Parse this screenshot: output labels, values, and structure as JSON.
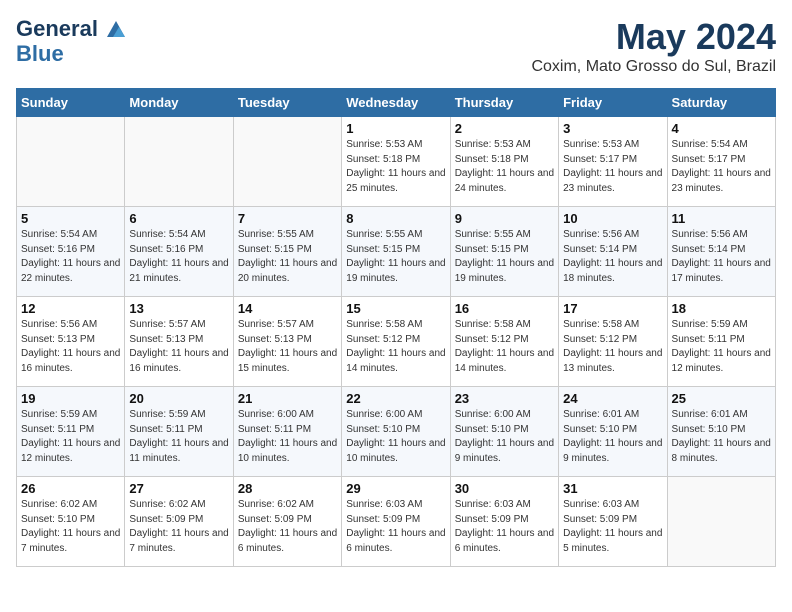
{
  "header": {
    "logo_line1": "General",
    "logo_line2": "Blue",
    "month": "May 2024",
    "location": "Coxim, Mato Grosso do Sul, Brazil"
  },
  "days_of_week": [
    "Sunday",
    "Monday",
    "Tuesday",
    "Wednesday",
    "Thursday",
    "Friday",
    "Saturday"
  ],
  "weeks": [
    [
      {
        "day": null
      },
      {
        "day": null
      },
      {
        "day": null
      },
      {
        "day": "1",
        "sunrise": "5:53 AM",
        "sunset": "5:18 PM",
        "daylight": "11 hours and 25 minutes."
      },
      {
        "day": "2",
        "sunrise": "5:53 AM",
        "sunset": "5:18 PM",
        "daylight": "11 hours and 24 minutes."
      },
      {
        "day": "3",
        "sunrise": "5:53 AM",
        "sunset": "5:17 PM",
        "daylight": "11 hours and 23 minutes."
      },
      {
        "day": "4",
        "sunrise": "5:54 AM",
        "sunset": "5:17 PM",
        "daylight": "11 hours and 23 minutes."
      }
    ],
    [
      {
        "day": "5",
        "sunrise": "5:54 AM",
        "sunset": "5:16 PM",
        "daylight": "11 hours and 22 minutes."
      },
      {
        "day": "6",
        "sunrise": "5:54 AM",
        "sunset": "5:16 PM",
        "daylight": "11 hours and 21 minutes."
      },
      {
        "day": "7",
        "sunrise": "5:55 AM",
        "sunset": "5:15 PM",
        "daylight": "11 hours and 20 minutes."
      },
      {
        "day": "8",
        "sunrise": "5:55 AM",
        "sunset": "5:15 PM",
        "daylight": "11 hours and 19 minutes."
      },
      {
        "day": "9",
        "sunrise": "5:55 AM",
        "sunset": "5:15 PM",
        "daylight": "11 hours and 19 minutes."
      },
      {
        "day": "10",
        "sunrise": "5:56 AM",
        "sunset": "5:14 PM",
        "daylight": "11 hours and 18 minutes."
      },
      {
        "day": "11",
        "sunrise": "5:56 AM",
        "sunset": "5:14 PM",
        "daylight": "11 hours and 17 minutes."
      }
    ],
    [
      {
        "day": "12",
        "sunrise": "5:56 AM",
        "sunset": "5:13 PM",
        "daylight": "11 hours and 16 minutes."
      },
      {
        "day": "13",
        "sunrise": "5:57 AM",
        "sunset": "5:13 PM",
        "daylight": "11 hours and 16 minutes."
      },
      {
        "day": "14",
        "sunrise": "5:57 AM",
        "sunset": "5:13 PM",
        "daylight": "11 hours and 15 minutes."
      },
      {
        "day": "15",
        "sunrise": "5:58 AM",
        "sunset": "5:12 PM",
        "daylight": "11 hours and 14 minutes."
      },
      {
        "day": "16",
        "sunrise": "5:58 AM",
        "sunset": "5:12 PM",
        "daylight": "11 hours and 14 minutes."
      },
      {
        "day": "17",
        "sunrise": "5:58 AM",
        "sunset": "5:12 PM",
        "daylight": "11 hours and 13 minutes."
      },
      {
        "day": "18",
        "sunrise": "5:59 AM",
        "sunset": "5:11 PM",
        "daylight": "11 hours and 12 minutes."
      }
    ],
    [
      {
        "day": "19",
        "sunrise": "5:59 AM",
        "sunset": "5:11 PM",
        "daylight": "11 hours and 12 minutes."
      },
      {
        "day": "20",
        "sunrise": "5:59 AM",
        "sunset": "5:11 PM",
        "daylight": "11 hours and 11 minutes."
      },
      {
        "day": "21",
        "sunrise": "6:00 AM",
        "sunset": "5:11 PM",
        "daylight": "11 hours and 10 minutes."
      },
      {
        "day": "22",
        "sunrise": "6:00 AM",
        "sunset": "5:10 PM",
        "daylight": "11 hours and 10 minutes."
      },
      {
        "day": "23",
        "sunrise": "6:00 AM",
        "sunset": "5:10 PM",
        "daylight": "11 hours and 9 minutes."
      },
      {
        "day": "24",
        "sunrise": "6:01 AM",
        "sunset": "5:10 PM",
        "daylight": "11 hours and 9 minutes."
      },
      {
        "day": "25",
        "sunrise": "6:01 AM",
        "sunset": "5:10 PM",
        "daylight": "11 hours and 8 minutes."
      }
    ],
    [
      {
        "day": "26",
        "sunrise": "6:02 AM",
        "sunset": "5:10 PM",
        "daylight": "11 hours and 7 minutes."
      },
      {
        "day": "27",
        "sunrise": "6:02 AM",
        "sunset": "5:09 PM",
        "daylight": "11 hours and 7 minutes."
      },
      {
        "day": "28",
        "sunrise": "6:02 AM",
        "sunset": "5:09 PM",
        "daylight": "11 hours and 6 minutes."
      },
      {
        "day": "29",
        "sunrise": "6:03 AM",
        "sunset": "5:09 PM",
        "daylight": "11 hours and 6 minutes."
      },
      {
        "day": "30",
        "sunrise": "6:03 AM",
        "sunset": "5:09 PM",
        "daylight": "11 hours and 6 minutes."
      },
      {
        "day": "31",
        "sunrise": "6:03 AM",
        "sunset": "5:09 PM",
        "daylight": "11 hours and 5 minutes."
      },
      {
        "day": null
      }
    ]
  ]
}
